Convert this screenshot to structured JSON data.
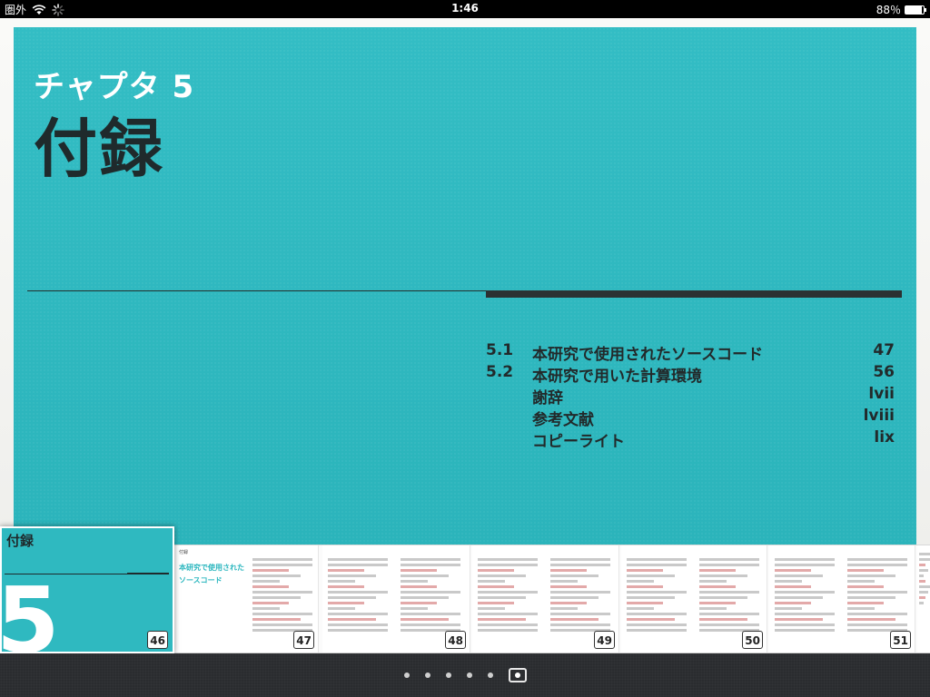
{
  "status_bar": {
    "carrier": "圏外",
    "time": "1:46",
    "battery_percent_label": "88％",
    "battery_level": 0.88
  },
  "page": {
    "chapter_label": "チャプタ 5",
    "chapter_title": "付録",
    "accent_color": "#2fb9c0",
    "toc": [
      {
        "num": "5.1",
        "title": "本研究で使用されたソースコード",
        "page": "47"
      },
      {
        "num": "5.2",
        "title": "本研究で用いた計算環境",
        "page": "56"
      },
      {
        "num": "",
        "title": "謝辞",
        "page": "lvii"
      },
      {
        "num": "",
        "title": "参考文献",
        "page": "lviii"
      },
      {
        "num": "",
        "title": "コピーライト",
        "page": "lix"
      }
    ]
  },
  "current_thumbnail": {
    "title": "付録",
    "number": "5",
    "page": "46"
  },
  "thumbnails": {
    "first_header": "付録",
    "first_title": "本研究で使用されたソースコード",
    "pages": [
      "47",
      "48",
      "49",
      "50",
      "51"
    ]
  },
  "page_dots": {
    "count": 6,
    "current_index": 5
  }
}
